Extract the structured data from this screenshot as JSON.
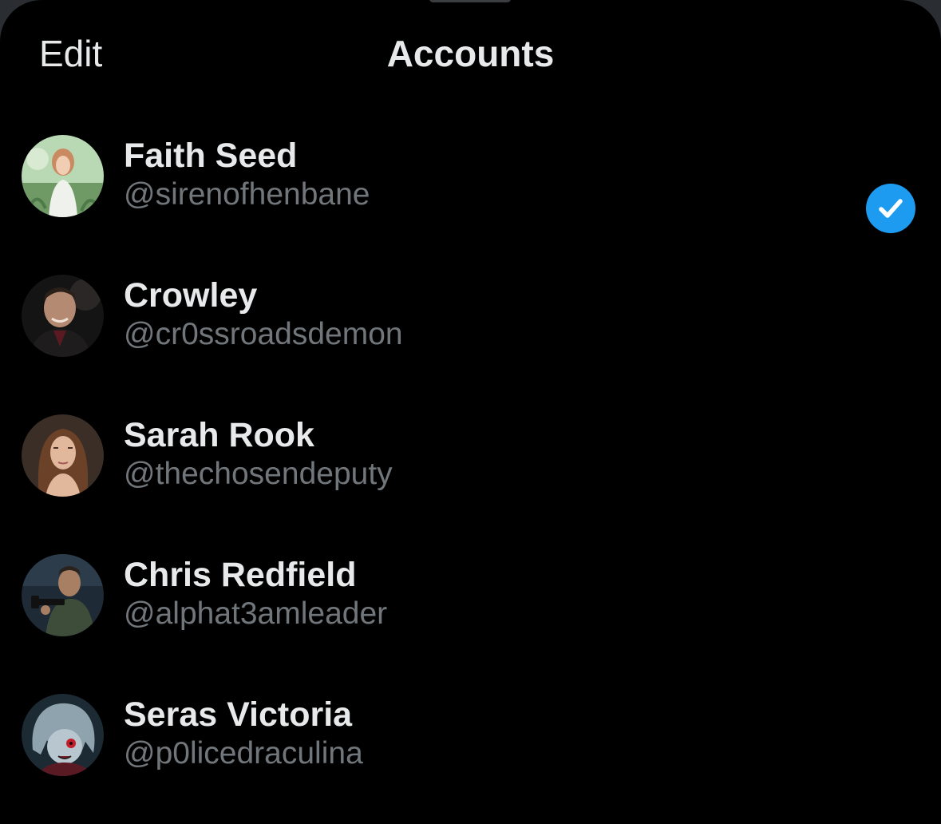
{
  "header": {
    "edit_label": "Edit",
    "title": "Accounts"
  },
  "accounts": [
    {
      "name": "Faith Seed",
      "handle": "@sirenofhenbane",
      "selected": false
    },
    {
      "name": "Crowley",
      "handle": "@cr0ssroadsdemon",
      "selected": true
    },
    {
      "name": "Sarah Rook",
      "handle": "@thechosendeputy",
      "selected": false
    },
    {
      "name": "Chris Redfield",
      "handle": "@alphat3amleader",
      "selected": false
    },
    {
      "name": "Seras Victoria",
      "handle": "@p0licedraculina",
      "selected": false
    }
  ],
  "colors": {
    "background": "#000000",
    "primary_text": "#e7e9ea",
    "secondary_text": "#71767b",
    "accent": "#1d9bf0"
  },
  "icons": {
    "selected_indicator": "checkmark-circle-icon"
  }
}
